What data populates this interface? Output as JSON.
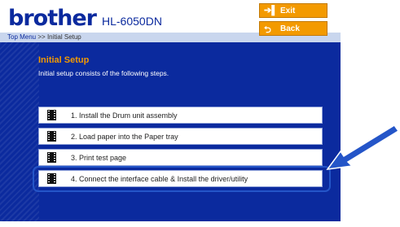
{
  "brand": "brother",
  "model": "HL-6050DN",
  "breadcrumb": {
    "link": "Top Menu",
    "separator": ">>",
    "current": "Initial Setup"
  },
  "nav": {
    "exit": "Exit",
    "back": "Back"
  },
  "section": {
    "title": "Initial Setup",
    "subtitle": "Initial setup consists of the following steps."
  },
  "steps": [
    {
      "label": "1. Install the Drum unit assembly"
    },
    {
      "label": "2. Load paper into the Paper tray"
    },
    {
      "label": "3. Print test page"
    },
    {
      "label": "4. Connect the interface cable & Install the driver/utility"
    }
  ],
  "colors": {
    "background": "#0b2a9e",
    "accent": "#f39a00",
    "highlight": "#2455c8"
  }
}
